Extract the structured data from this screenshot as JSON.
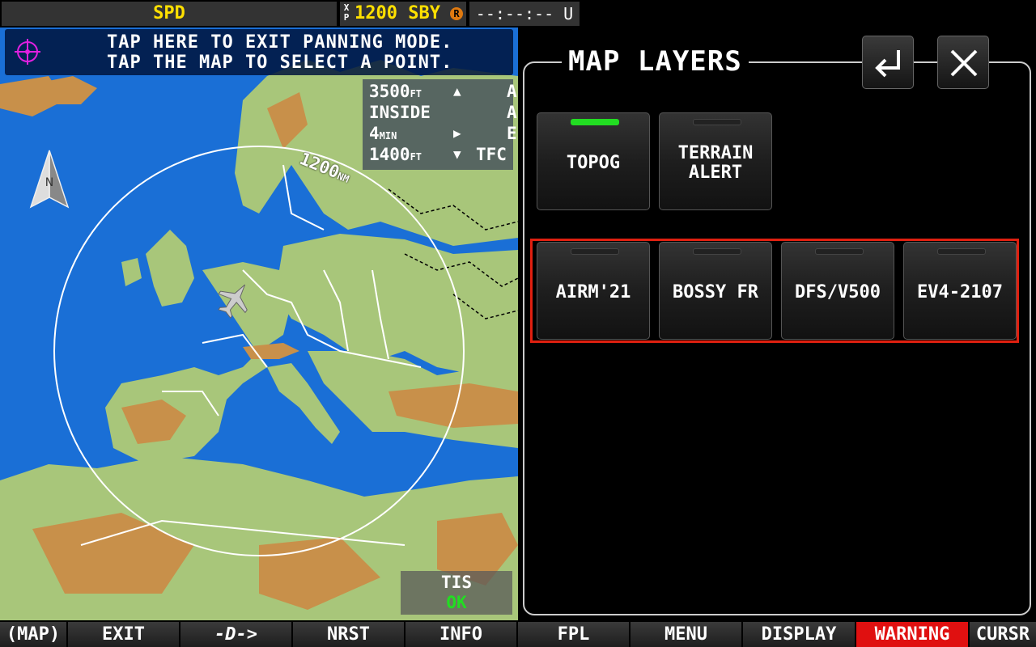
{
  "topbar": {
    "speed_label": "SPD",
    "xpdr_mode_glyph_top": "X",
    "xpdr_mode_glyph_bottom": "P",
    "xpdr_code": "1200",
    "xpdr_state": "SBY",
    "xpdr_reply_badge": "R",
    "timer": "--:--:-- U"
  },
  "map": {
    "pan_banner_line1": "TAP HERE TO EXIT PANNING MODE.",
    "pan_banner_line2": "TAP THE MAP TO SELECT A POINT.",
    "range_value": "1200",
    "range_unit": "NM",
    "north_label": "N",
    "alt_box": [
      {
        "value": "3500",
        "unit": "FT",
        "arrow": "▲",
        "key": "A"
      },
      {
        "value": "INSIDE",
        "unit": "",
        "arrow": "",
        "key": "A"
      },
      {
        "value": "4",
        "unit": "MIN",
        "arrow": "▶",
        "key": "E"
      },
      {
        "value": "1400",
        "unit": "FT",
        "arrow": "▼",
        "key": "TFC"
      }
    ],
    "tis_label": "TIS",
    "tis_status": "OK",
    "colors": {
      "water": "#1a6fd6",
      "land": "#a8c67a",
      "terrain": "#c8904a"
    }
  },
  "layers_panel": {
    "title": "MAP LAYERS",
    "enter_icon": "enter-icon",
    "close_icon": "close-icon",
    "row1": [
      {
        "label": "TOPOG",
        "active": true
      },
      {
        "label": "TERRAIN\nALERT",
        "active": false
      }
    ],
    "row2": [
      {
        "label": "AIRM'21",
        "active": false
      },
      {
        "label": "BOSSY FR",
        "active": false
      },
      {
        "label": "DFS/V500",
        "active": false
      },
      {
        "label": "EV4-2107",
        "active": false
      }
    ],
    "active_color": "#22dd22",
    "highlight_color": "#e02010"
  },
  "softkeys": [
    {
      "label": "(MAP)"
    },
    {
      "label": "EXIT"
    },
    {
      "label": "-D->"
    },
    {
      "label": "NRST"
    },
    {
      "label": "INFO"
    },
    {
      "label": "FPL"
    },
    {
      "label": "MENU"
    },
    {
      "label": "DISPLAY"
    },
    {
      "label": "WARNING"
    },
    {
      "label": "CURSR"
    }
  ]
}
